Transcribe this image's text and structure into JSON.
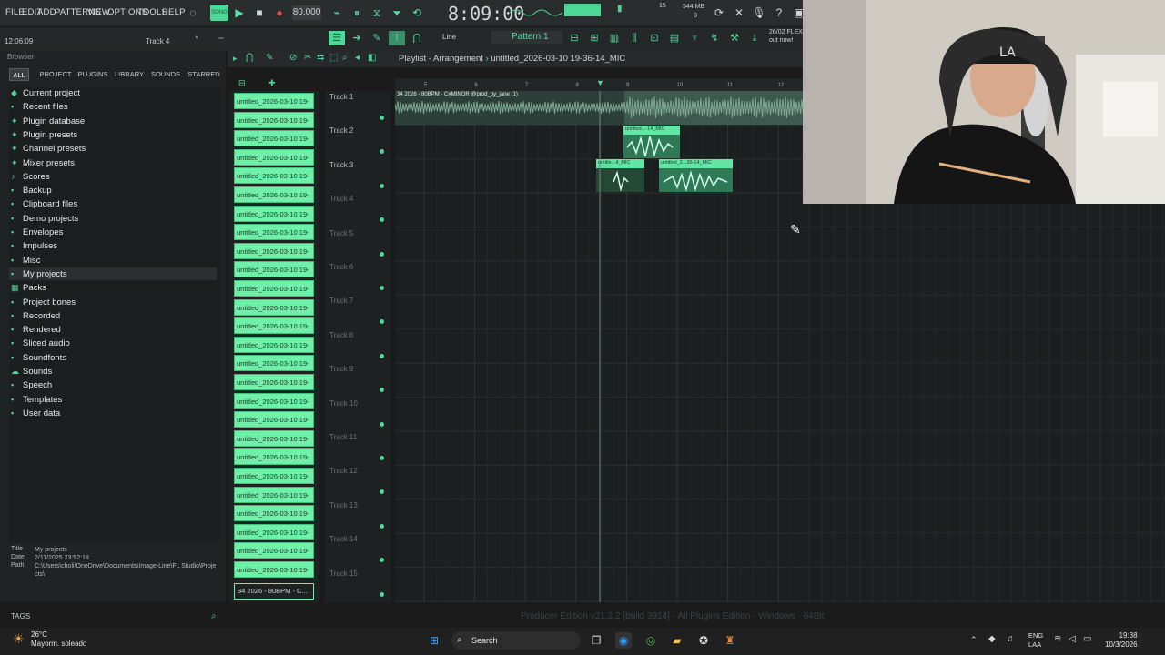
{
  "menu": [
    "FILE",
    "EDIT",
    "ADD",
    "PATTERNS",
    "VIEW",
    "OPTIONS",
    "TOOLS",
    "HELP"
  ],
  "transport": {
    "tempo": "80.000",
    "song_time": "8:09:00",
    "cpu_top": "15",
    "ram": "544 MB",
    "cpu_bottom": "0"
  },
  "toolbar": {
    "hint_time": "12:06:09",
    "hint_track": "Track 4",
    "snap": "Line",
    "pattern": "Pattern 1",
    "news_line1": "26/02 FLEX",
    "news_line2": "out now!"
  },
  "browser": {
    "title": "Browser",
    "tabs": [
      "ALL",
      "PROJECT",
      "PLUGINS",
      "LIBRARY",
      "SOUNDS",
      "STARRED"
    ],
    "items": [
      {
        "label": "Current project",
        "icon": "project-icon"
      },
      {
        "label": "Recent files",
        "icon": "folder-icon"
      },
      {
        "label": "Plugin database",
        "icon": "plug-icon"
      },
      {
        "label": "Plugin presets",
        "icon": "plug-icon"
      },
      {
        "label": "Channel presets",
        "icon": "plug-icon"
      },
      {
        "label": "Mixer presets",
        "icon": "plug-icon"
      },
      {
        "label": "Scores",
        "icon": "note-icon"
      },
      {
        "label": "Backup",
        "icon": "folder-icon"
      },
      {
        "label": "Clipboard files",
        "icon": "folder-icon"
      },
      {
        "label": "Demo projects",
        "icon": "folder-icon"
      },
      {
        "label": "Envelopes",
        "icon": "folder-icon"
      },
      {
        "label": "Impulses",
        "icon": "folder-icon"
      },
      {
        "label": "Misc",
        "icon": "folder-icon"
      },
      {
        "label": "My projects",
        "icon": "folder-icon"
      },
      {
        "label": "Packs",
        "icon": "packs-icon"
      },
      {
        "label": "Project bones",
        "icon": "folder-icon"
      },
      {
        "label": "Recorded",
        "icon": "folder-icon"
      },
      {
        "label": "Rendered",
        "icon": "folder-icon"
      },
      {
        "label": "Sliced audio",
        "icon": "folder-icon"
      },
      {
        "label": "Soundfonts",
        "icon": "folder-icon"
      },
      {
        "label": "Sounds",
        "icon": "cloud-icon"
      },
      {
        "label": "Speech",
        "icon": "folder-icon"
      },
      {
        "label": "Templates",
        "icon": "folder-icon"
      },
      {
        "label": "User data",
        "icon": "folder-icon"
      }
    ],
    "selected_index": 13,
    "info": {
      "title_key": "Title",
      "title_val": "My projects",
      "date_key": "Date",
      "date_val": "2/11/2025 23:52:18",
      "path_key": "Path",
      "path_val": "C:\\Users\\choli\\OneDrive\\Documents\\Image-Line\\FL Studio\\Projects\\"
    },
    "tags_label": "TAGS"
  },
  "picker": {
    "clips": [
      "untitled_2026-03-10 19-",
      "untitled_2026-03-10 19-",
      "untitled_2026-03-10 19-",
      "untitled_2026-03-10 19-",
      "untitled_2026-03-10 19-",
      "untitled_2026-03-10 19-",
      "untitled_2026-03-10 19-",
      "untitled_2026-03-10 19-",
      "untitled_2026-03-10 19-",
      "untitled_2026-03-10 19-",
      "untitled_2026-03-10 19-",
      "untitled_2026-03-10 19-",
      "untitled_2026-03-10 19-",
      "untitled_2026-03-10 19-",
      "untitled_2026-03-10 19-",
      "untitled_2026-03-10 19-",
      "untitled_2026-03-10 19-",
      "untitled_2026-03-10 19-",
      "untitled_2026-03-10 19-",
      "untitled_2026-03-10 19-",
      "untitled_2026-03-10 19-",
      "untitled_2026-03-10 19-",
      "untitled_2026-03-10 19-",
      "untitled_2026-03-10 19-",
      "untitled_2026-03-10 19-",
      "untitled_2026-03-10 19-"
    ],
    "last": "34 2026 - 80BPM - C..."
  },
  "playlist": {
    "title": "Playlist - Arrangement",
    "file": "untitled_2026-03-10 19-36-14_MIC",
    "tracks": [
      "Track 1",
      "Track 2",
      "Track 3",
      "Track 4",
      "Track 5",
      "Track 6",
      "Track 7",
      "Track 8",
      "Track 9",
      "Track 10",
      "Track 11",
      "Track 12",
      "Track 13",
      "Track 14",
      "Track 15"
    ],
    "bars": [
      "5",
      "6",
      "7",
      "8",
      "9",
      "10",
      "11",
      "12"
    ],
    "clip1_label": "34 2026 - 80BPM - C#MINOR @prod_by_jane (1)",
    "clip2_label": "untitled...-14_MIC",
    "clip3a_label": "untitle...4_MIC",
    "clip3b_label": "untitled_2...36-14_MIC"
  },
  "status": {
    "edition": "Producer Edition v21.2.2 [build 3914] - All Plugins Edition - Windows - 64Bit"
  },
  "taskbar": {
    "weather_temp": "26°C",
    "weather_desc": "Mayorm. soleado",
    "search": "Search",
    "lang1": "ENG",
    "lang2": "LAA",
    "time": "19:38",
    "date": "10/3/2026"
  },
  "colors": {
    "accent": "#55e0a6",
    "clip": "#6ff0a8",
    "background": "#1c1f20"
  }
}
